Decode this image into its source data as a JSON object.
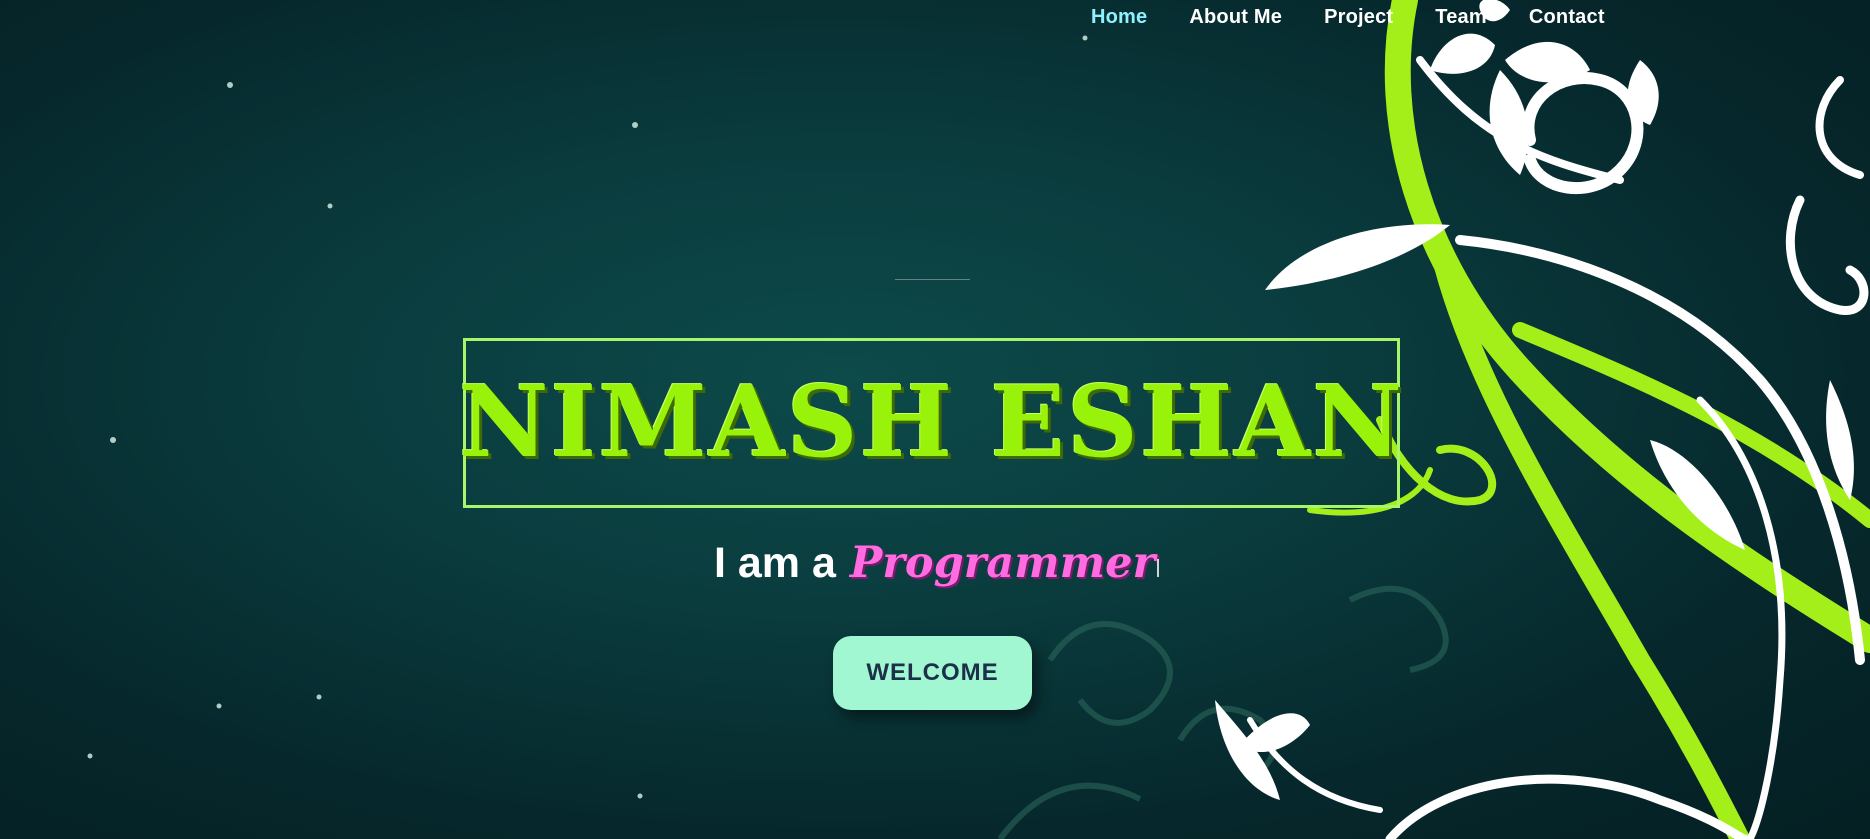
{
  "nav": {
    "items": [
      {
        "label": "Home",
        "active": true
      },
      {
        "label": "About Me",
        "active": false
      },
      {
        "label": "Project",
        "active": false
      },
      {
        "label": "Team",
        "active": false
      },
      {
        "label": "Contact",
        "active": false
      }
    ]
  },
  "hero": {
    "name": "NIMASH ESHAN",
    "tagline_prefix": "I am a",
    "tagline_role": "Programmer",
    "button_label": "WELCOME"
  },
  "colors": {
    "name_green": "#98f20a",
    "box_border": "#a6f56a",
    "role_pink": "#ff6be0",
    "button_bg": "#a1f7d1",
    "button_text": "#1d3049",
    "nav_active": "#8ff0ff",
    "background": "#0a3c3e"
  }
}
